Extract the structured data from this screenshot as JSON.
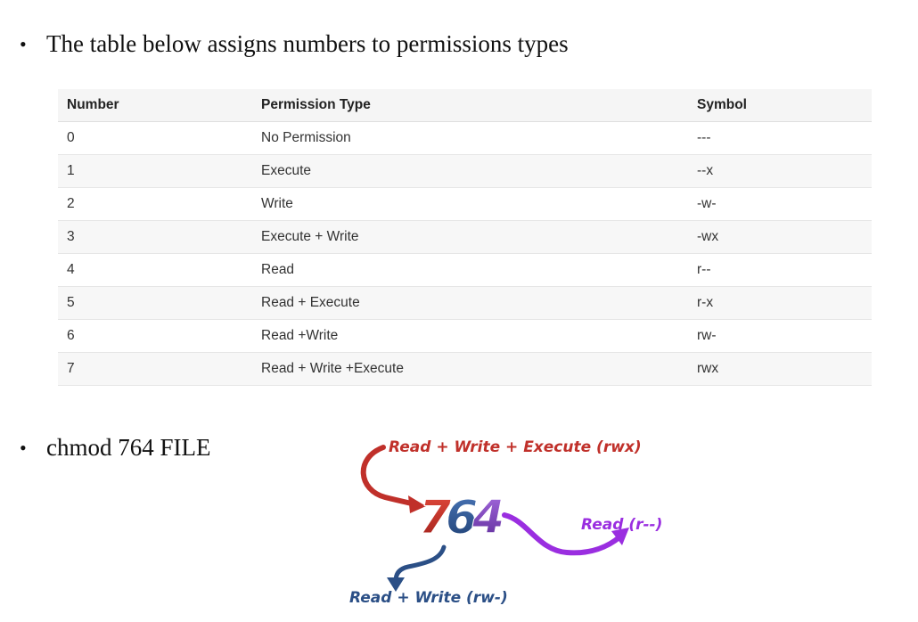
{
  "bullets": {
    "first": "The table below assigns numbers to permissions types",
    "second": "chmod 764 FILE",
    "marker": "•"
  },
  "table": {
    "headers": [
      "Number",
      "Permission Type",
      "Symbol"
    ],
    "rows": [
      [
        "0",
        "No Permission",
        "---"
      ],
      [
        "1",
        "Execute",
        "--x"
      ],
      [
        "2",
        "Write",
        "-w-"
      ],
      [
        "3",
        "Execute + Write",
        "-wx"
      ],
      [
        "4",
        "Read",
        "r--"
      ],
      [
        "5",
        "Read + Execute",
        "r-x"
      ],
      [
        "6",
        "Read +Write",
        "rw-"
      ],
      [
        "7",
        "Read + Write +Execute",
        "rwx"
      ]
    ]
  },
  "diagram": {
    "digits": [
      "7",
      "6",
      "4"
    ],
    "label_owner": "Read + Write + Execute (rwx)",
    "label_group": "Read + Write (rw-)",
    "label_other": "Read (r--)",
    "colors": {
      "owner": "#c0302a",
      "group": "#2b4f86",
      "other": "#9a2ee0"
    }
  }
}
